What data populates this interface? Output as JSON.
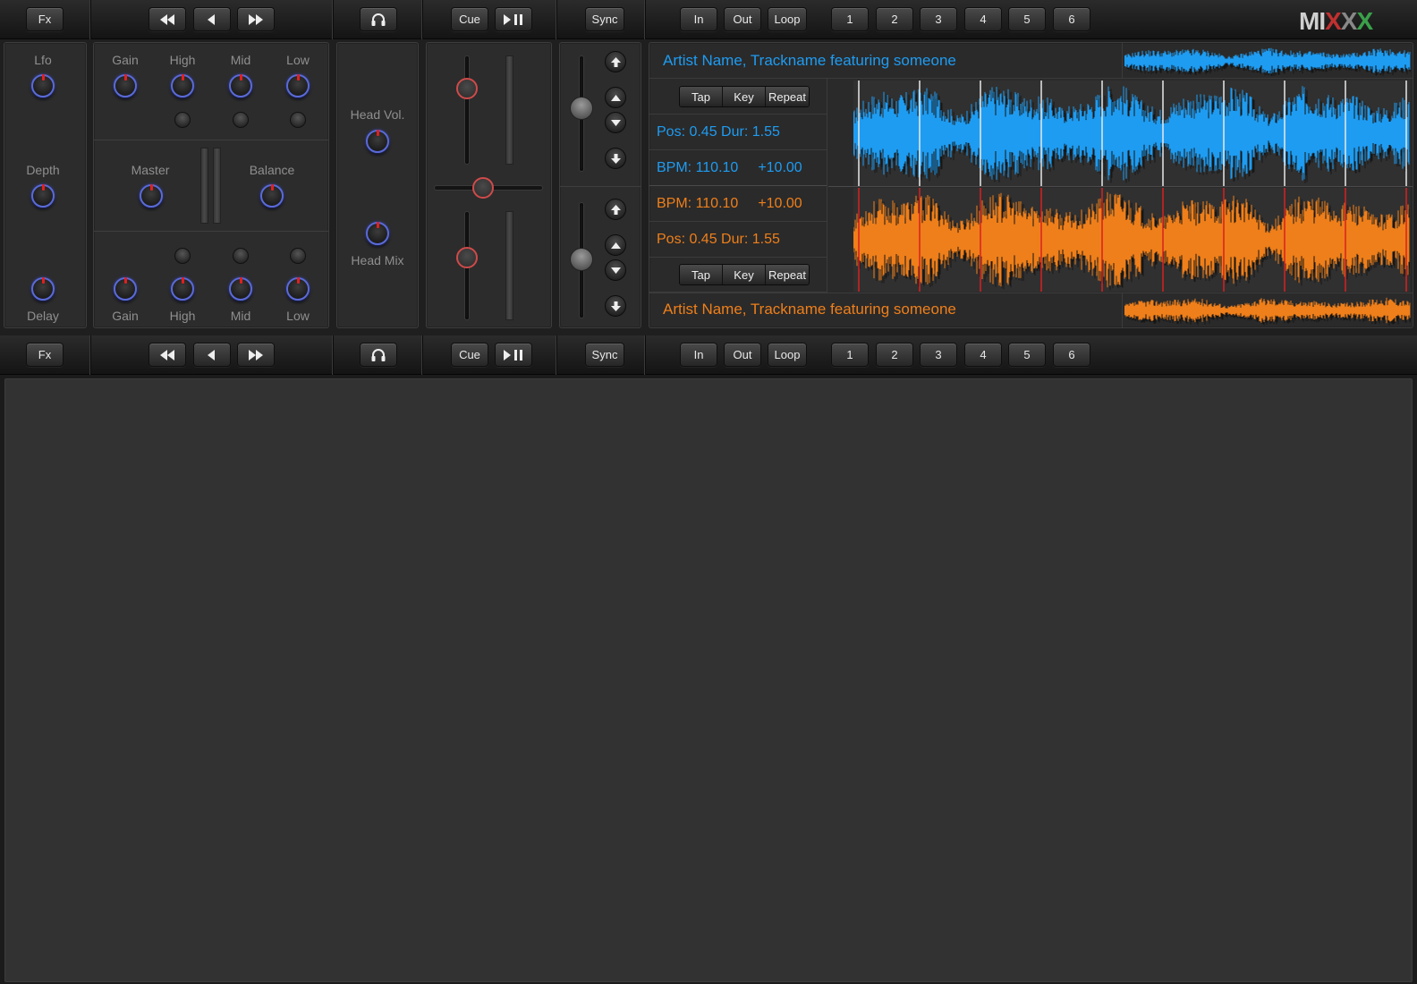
{
  "colors": {
    "deck1": "#1e9cf2",
    "deck2": "#ef7f1a",
    "knob_ring": "#5a6ad8",
    "indicator": "#e02020",
    "beat_marker_deck2": "#d82020"
  },
  "logo": {
    "text": "MIXXX",
    "letters": [
      "M",
      "I",
      "X",
      "X",
      "X"
    ]
  },
  "transport": {
    "fx_label": "Fx",
    "cue_label": "Cue",
    "sync_label": "Sync",
    "in_label": "In",
    "out_label": "Out",
    "loop_label": "Loop",
    "hotcues": [
      "1",
      "2",
      "3",
      "4",
      "5",
      "6"
    ],
    "icons": [
      "fast-rewind-icon",
      "rewind-icon",
      "fast-forward-icon",
      "headphones-icon",
      "play-pause-icon"
    ]
  },
  "fx_panel": {
    "labels": [
      "Lfo",
      "Depth",
      "Delay"
    ]
  },
  "eq_panel": {
    "top_labels": [
      "Gain",
      "High",
      "Mid",
      "Low"
    ],
    "bottom_labels": [
      "Gain",
      "High",
      "Mid",
      "Low"
    ],
    "master_label": "Master",
    "balance_label": "Balance"
  },
  "head_panel": {
    "head_vol_label": "Head Vol.",
    "head_mix_label": "Head Mix"
  },
  "deck1": {
    "track_title": "Artist Name, Trackname featuring someone",
    "pos_dur": "Pos: 0.45 Dur: 1.55",
    "bpm": "BPM: 110.10",
    "pitch": "+10.00",
    "seg_buttons": [
      "Tap",
      "Key",
      "Repeat"
    ]
  },
  "deck2": {
    "track_title": "Artist Name, Trackname featuring someone",
    "pos_dur": "Pos: 0.45 Dur: 1.55",
    "bpm": "BPM: 110.10",
    "pitch": "+10.00",
    "seg_buttons": [
      "Tap",
      "Key",
      "Repeat"
    ]
  }
}
